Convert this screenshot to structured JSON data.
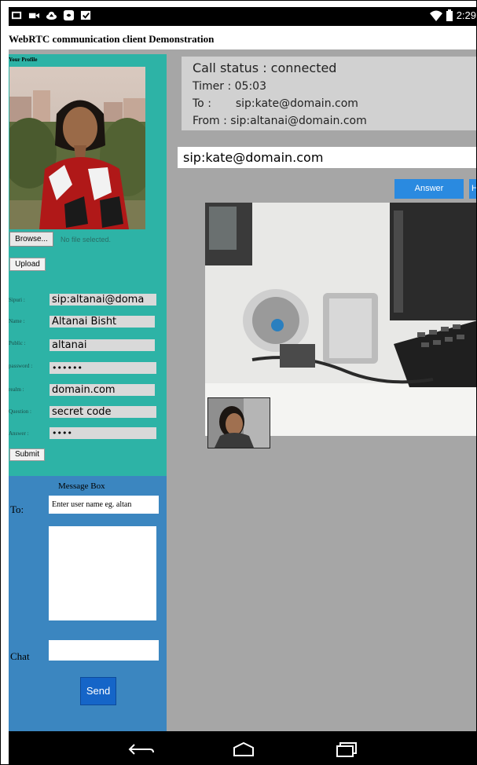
{
  "status_bar": {
    "time": "2:29",
    "left_icons": [
      "screen-icon",
      "video-icon",
      "cloud-upload-icon",
      "app-icon",
      "checkbox-icon"
    ],
    "right_icons": [
      "wifi-icon",
      "battery-icon"
    ]
  },
  "app": {
    "title": "WebRTC communication client Demonstration"
  },
  "profile": {
    "heading": "Your Profile",
    "browse_label": "Browse...",
    "no_file_text": "No file selected.",
    "upload_label": "Upload",
    "fields": [
      {
        "label": "Sipuri :",
        "value": "sip:altanai@doma"
      },
      {
        "label": "Name :",
        "value": "Altanai Bisht"
      },
      {
        "label": "Public :",
        "value": "altanai"
      },
      {
        "label": "password :",
        "value": "••••••"
      },
      {
        "label": "realm :",
        "value": "domain.com"
      },
      {
        "label": "Question :",
        "value": "secret code"
      },
      {
        "label": "Answer :",
        "value": "••••"
      }
    ],
    "submit_label": "Submit"
  },
  "message_box": {
    "heading": "Message Box",
    "to_label": "To:",
    "to_value": "Enter user name eg. altan",
    "chat_label": "Chat",
    "send_label": "Send"
  },
  "call": {
    "status_line": "Call status : connected",
    "timer_line_label": "Timer :",
    "timer_value": "05:03",
    "to_line_label": "To :",
    "to_value": "sip:kate@domain.com",
    "from_line": "From : sip:altanai@domain.com",
    "sip_input_value": "sip:kate@domain.com",
    "answer_label": "Answer",
    "hangup_label": "H"
  },
  "nav_bar": {
    "buttons": [
      "back-icon",
      "home-icon",
      "recent-apps-icon"
    ]
  },
  "colors": {
    "profile_panel": "#2db3a6",
    "message_panel": "#3b86c0",
    "content_background": "#a6a6a6",
    "answer_button": "#2a8ae0",
    "send_button": "#1565c8"
  }
}
